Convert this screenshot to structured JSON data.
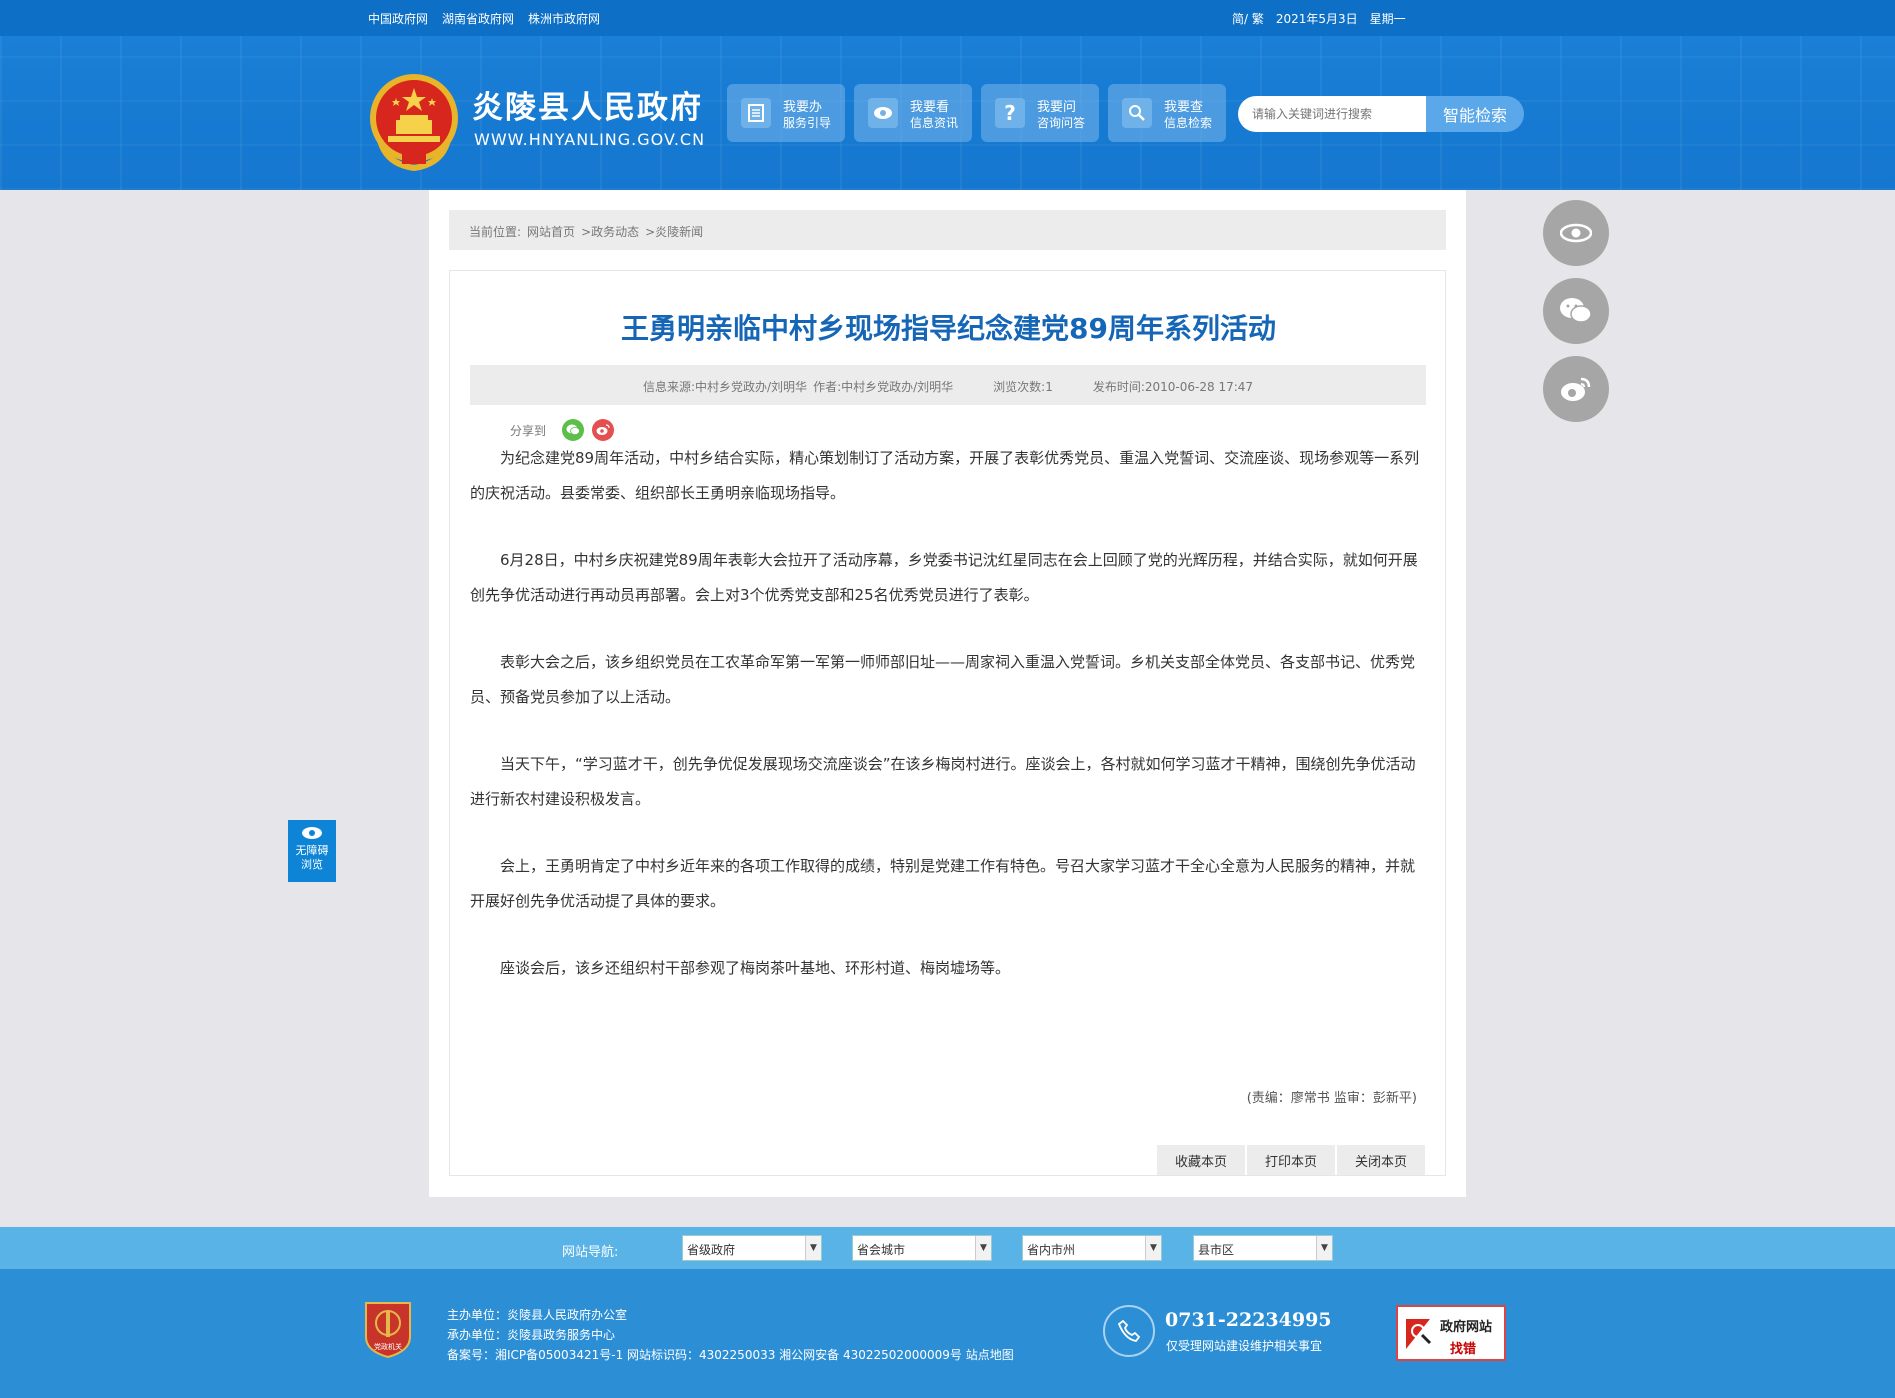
{
  "topbar": {
    "links": [
      "中国政府网",
      "湖南省政府网",
      "株洲市政府网"
    ],
    "lang": "简/ 繁",
    "date": "2021年5月3日",
    "weekday": "星期一"
  },
  "header": {
    "site_name": "炎陵县人民政府",
    "site_url": "WWW.HNYANLING.GOV.CN",
    "quick_links": [
      {
        "title": "我要办",
        "sub": "服务引导",
        "icon": "document-icon"
      },
      {
        "title": "我要看",
        "sub": "信息资讯",
        "icon": "eye-icon"
      },
      {
        "title": "我要问",
        "sub": "咨询问答",
        "icon": "question-icon"
      },
      {
        "title": "我要查",
        "sub": "信息检索",
        "icon": "search-icon"
      }
    ],
    "search_placeholder": "请输入关键词进行搜索",
    "search_button": "智能检索"
  },
  "breadcrumb": {
    "label": "当前位置:",
    "items": [
      "网站首页",
      ">政务动态",
      ">炎陵新闻"
    ]
  },
  "article": {
    "title": "王勇明亲临中村乡现场指导纪念建党89周年系列活动",
    "meta": {
      "source": "信息来源:中村乡党政办/刘明华",
      "author": "作者:中村乡党政办/刘明华",
      "views": "浏览次数:1",
      "published": "发布时间:2010-06-28 17:47"
    },
    "share_label": "分享到",
    "paragraphs": [
      "为纪念建党89周年活动，中村乡结合实际，精心策划制订了活动方案，开展了表彰优秀党员、重温入党誓词、交流座谈、现场参观等一系列的庆祝活动。县委常委、组织部长王勇明亲临现场指导。",
      "6月28日，中村乡庆祝建党89周年表彰大会拉开了活动序幕，乡党委书记沈红星同志在会上回顾了党的光辉历程，并结合实际，就如何开展创先争优活动进行再动员再部署。会上对3个优秀党支部和25名优秀党员进行了表彰。",
      "表彰大会之后，该乡组织党员在工农革命军第一军第一师师部旧址——周家祠入重温入党誓词。乡机关支部全体党员、各支部书记、优秀党员、预备党员参加了以上活动。",
      "当天下午，“学习蓝才干，创先争优促发展现场交流座谈会”在该乡梅岗村进行。座谈会上，各村就如何学习蓝才干精神，围绕创先争优活动进行新农村建设积极发言。",
      "会上，王勇明肯定了中村乡近年来的各项工作取得的成绩，特别是党建工作有特色。号召大家学习蓝才干全心全意为人民服务的精神，并就开展好创先争优活动提了具体的要求。",
      "座谈会后，该乡还组织村干部参观了梅岗茶叶基地、环形村道、梅岗墟场等。"
    ],
    "editor": "(责编：廖常书  监审：彭新平)",
    "actions": [
      "收藏本页",
      "打印本页",
      "关闭本页"
    ]
  },
  "side_tools": [
    "eye-icon",
    "wechat-icon",
    "weibo-icon"
  ],
  "accessibility": {
    "line1": "无障碍",
    "line2": "浏览"
  },
  "footer_nav": {
    "label": "网站导航:",
    "selects": [
      "省级政府",
      "省会城市",
      "省内市州",
      "县市区"
    ]
  },
  "footer": {
    "badge_text": "党政机关",
    "host": "主办单位：炎陵县人民政府办公室",
    "organizer": "承办单位：炎陵县政务服务中心",
    "record": "备案号：湘ICP备05003421号-1 网站标识码：4302250033 湘公网安备 43022502000009号 站点地图",
    "phone": "0731-22234995",
    "phone_note": "仅受理网站建设维护相关事宜",
    "error_title": "政府网站",
    "error_sub": "找错"
  },
  "colors": {
    "brand_blue": "#1577cf",
    "title_blue": "#1666b7",
    "footer_blue": "#2c8fd6"
  }
}
